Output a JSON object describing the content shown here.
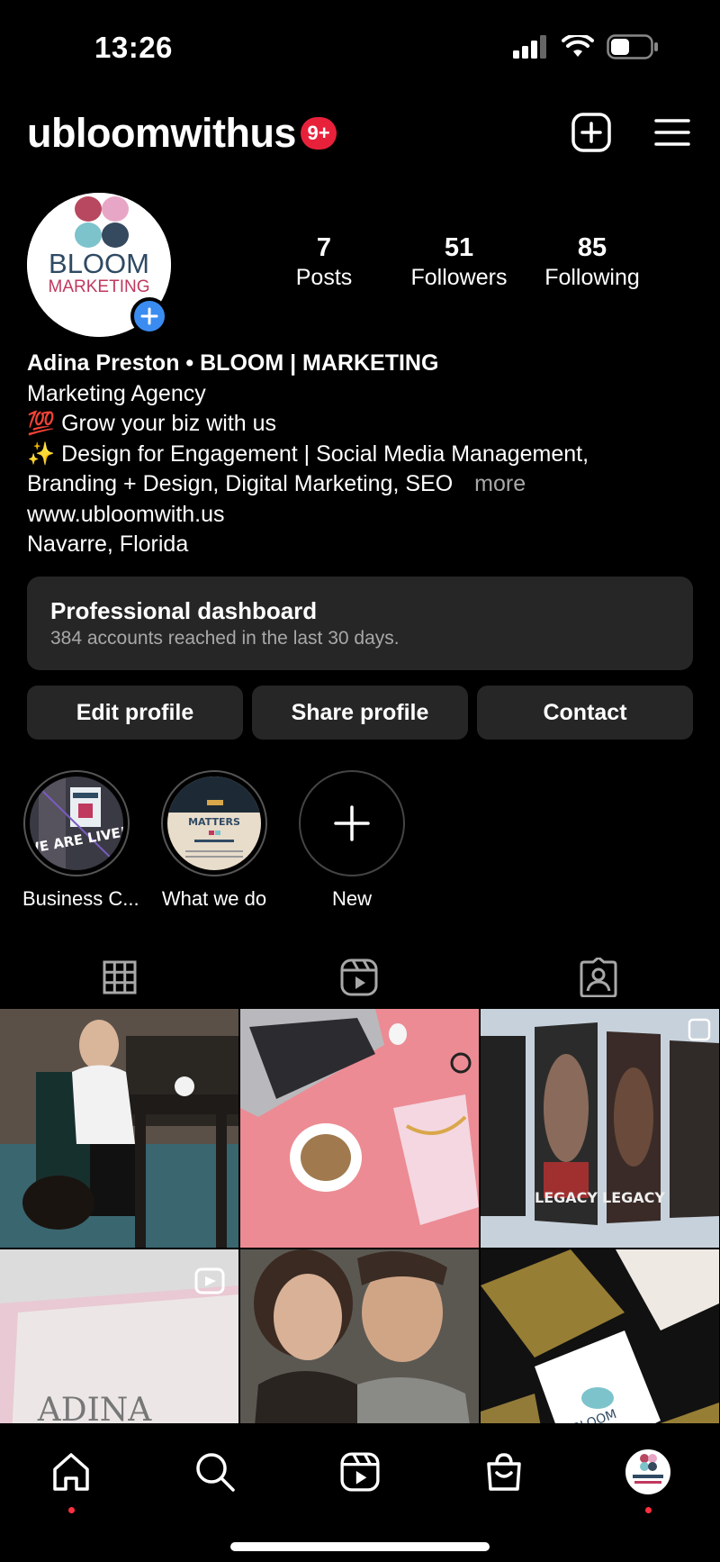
{
  "status_bar": {
    "time": "13:26"
  },
  "header": {
    "username": "ubloomwithus",
    "notification_badge": "9+"
  },
  "profile": {
    "avatar_text_top": "BLOOM",
    "avatar_text_bottom": "MARKETING",
    "stats": [
      {
        "value": "7",
        "label": "Posts"
      },
      {
        "value": "51",
        "label": "Followers"
      },
      {
        "value": "85",
        "label": "Following"
      }
    ],
    "bio": {
      "name": "Adina Preston • BLOOM | MARKETING",
      "category": "Marketing Agency",
      "line1": "💯  Grow your biz with us",
      "line2": "✨  Design for Engagement | Social Media Management,",
      "line3": "Branding + Design, Digital Marketing, SEO",
      "more": "more",
      "website": "www.ubloomwith.us",
      "location": "Navarre, Florida"
    }
  },
  "dashboard": {
    "title": "Professional dashboard",
    "subtitle": "384 accounts reached in the last 30 days."
  },
  "buttons": {
    "edit": "Edit profile",
    "share": "Share profile",
    "contact": "Contact"
  },
  "highlights": [
    {
      "label": "Business C...",
      "cover_text": "WE ARE LIVE!"
    },
    {
      "label": "What we do",
      "cover_text": "MATTERS"
    },
    {
      "label": "New"
    }
  ],
  "colors": {
    "badge": "#e8213b",
    "accent_blue": "#3b8cf0",
    "dark_surface": "#262626",
    "dot": "#ff3040"
  }
}
